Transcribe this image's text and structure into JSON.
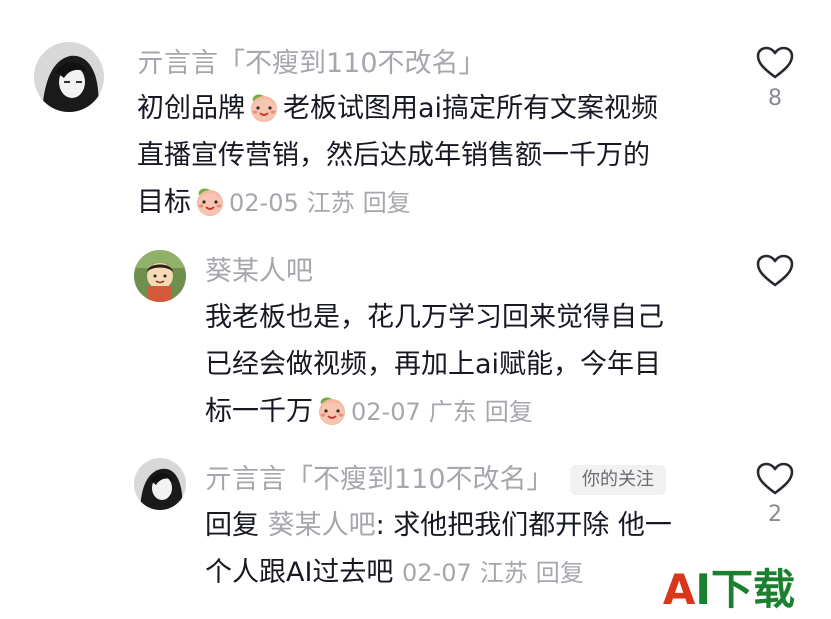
{
  "comments": [
    {
      "username": "亓言言「不瘦到110不改名」",
      "lines": [
        "初创品牌",
        "老板试图用ai搞定所有文案视频",
        "直播宣传营销，然后达成年销售额一千万的",
        "目标"
      ],
      "date": "02-05",
      "location": "江苏",
      "reply_label": "回复",
      "like_count": "8",
      "emoji": "smiling-peach-emoji"
    },
    {
      "username": "葵某人吧",
      "lines": [
        "我老板也是，花几万学习回来觉得自己",
        "已经会做视频，再加上ai赋能，今年目",
        "标一千万"
      ],
      "date": "02-07",
      "location": "广东",
      "reply_label": "回复",
      "like_count": "",
      "emoji": "smiling-peach-emoji"
    },
    {
      "username": "亓言言「不瘦到110不改名」",
      "badge": "你的关注",
      "reply_prefix": "回复",
      "mention": "葵某人吧",
      "lines": [
        ": 求他把我们都开除 他一",
        "个人跟AI过去吧"
      ],
      "date": "02-07",
      "location": "江苏",
      "reply_label": "回复",
      "like_count": "2"
    }
  ],
  "watermark": {
    "a": "A",
    "rest": "I下载"
  },
  "colors": {
    "text": "#161823",
    "muted": "#a6a6ad",
    "watermark_red": "#d9361a",
    "watermark_green": "#1a7f2e"
  }
}
